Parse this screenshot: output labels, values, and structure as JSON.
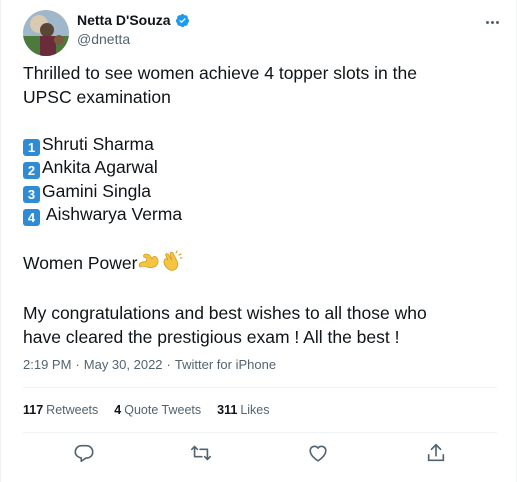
{
  "author": {
    "display_name": "Netta D'Souza",
    "handle": "@dnetta",
    "verified": true
  },
  "tweet": {
    "line1": "Thrilled to see women achieve 4 topper slots in the",
    "line2": "UPSC examination",
    "toppers": [
      {
        "rank": "1",
        "name": "Shruti Sharma"
      },
      {
        "rank": "2",
        "name": "Ankita Agarwal"
      },
      {
        "rank": "3",
        "name": "Gamini Singla"
      },
      {
        "rank": "4",
        "name": " Aishwarya Verma"
      }
    ],
    "power_text": "Women Power",
    "power_emojis": [
      "flexed-biceps-emoji",
      "clapping-hands-emoji"
    ],
    "closing_line1": "My congratulations and best wishes to all those who",
    "closing_line2": "have cleared the prestigious exam ! All the best !"
  },
  "meta": {
    "time": "2:19 PM",
    "separator1": "·",
    "date": "May 30, 2022",
    "separator2": "·",
    "source": "Twitter for iPhone"
  },
  "stats": {
    "retweets_count": "117",
    "retweets_label": "Retweets",
    "quotes_count": "4",
    "quotes_label": "Quote Tweets",
    "likes_count": "311",
    "likes_label": "Likes"
  },
  "icons": {
    "more": "more-icon",
    "reply": "reply-icon",
    "retweet": "retweet-icon",
    "like": "like-icon",
    "share": "share-icon",
    "verified": "verified-badge-icon"
  },
  "colors": {
    "text": "#0f1419",
    "secondary": "#536471",
    "verified_blue": "#1d9bf0",
    "number_badge": "#2e8bd4",
    "divider": "#eff3f4"
  }
}
